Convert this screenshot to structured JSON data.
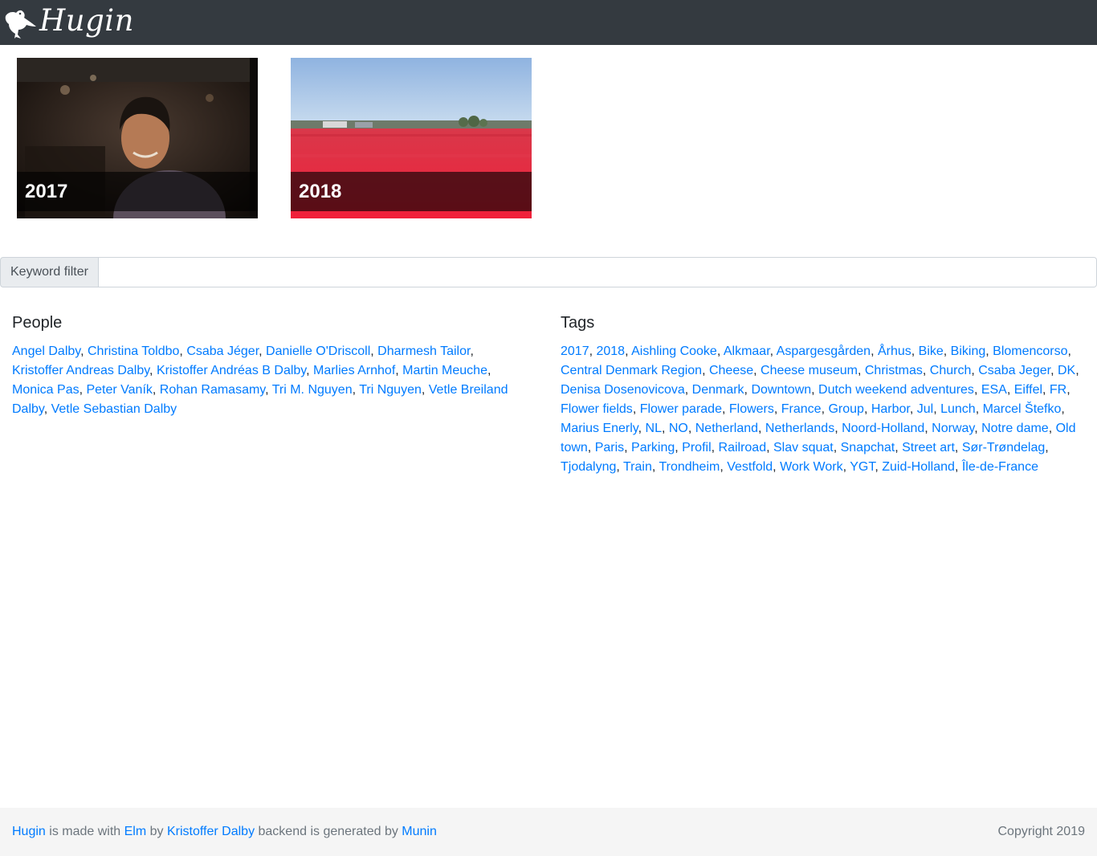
{
  "header": {
    "brand": "Hugin",
    "logo_icon": "raven-icon"
  },
  "albums": [
    {
      "year": "2017"
    },
    {
      "year": "2018"
    }
  ],
  "filter": {
    "label": "Keyword filter",
    "value": "",
    "placeholder": ""
  },
  "people": {
    "heading": "People",
    "items": [
      "Angel Dalby",
      "Christina Toldbo",
      "Csaba Jéger",
      "Danielle O'Driscoll",
      "Dharmesh Tailor",
      "Kristoffer Andreas Dalby",
      "Kristoffer Andréas B Dalby",
      "Marlies Arnhof",
      "Martin Meuche",
      "Monica Pas",
      "Peter Vaník",
      "Rohan Ramasamy",
      "Tri M. Nguyen",
      "Tri Nguyen",
      "Vetle Breiland Dalby",
      "Vetle Sebastian Dalby"
    ]
  },
  "tags": {
    "heading": "Tags",
    "items": [
      "2017",
      "2018",
      "Aishling Cooke",
      "Alkmaar",
      "Aspargesgården",
      "Århus",
      "Bike",
      "Biking",
      "Blomencorso",
      "Central Denmark Region",
      "Cheese",
      "Cheese museum",
      "Christmas",
      "Church",
      "Csaba Jeger",
      "DK",
      "Denisa Dosenovicova",
      "Denmark",
      "Downtown",
      "Dutch weekend adventures",
      "ESA",
      "Eiffel",
      "FR",
      "Flower fields",
      "Flower parade",
      "Flowers",
      "France",
      "Group",
      "Harbor",
      "Jul",
      "Lunch",
      "Marcel Štefko",
      "Marius Enerly",
      "NL",
      "NO",
      "Netherland",
      "Netherlands",
      "Noord-Holland",
      "Norway",
      "Notre dame",
      "Old town",
      "Paris",
      "Parking",
      "Profil",
      "Railroad",
      "Slav squat",
      "Snapchat",
      "Street art",
      "Sør-Trøndelag",
      "Tjodalyng",
      "Train",
      "Trondheim",
      "Vestfold",
      "Work Work",
      "YGT",
      "Zuid-Holland",
      "Île-de-France"
    ]
  },
  "footer": {
    "hugin_link": "Hugin",
    "text1": " is made with ",
    "elm_link": "Elm",
    "text2": " by ",
    "author_link": "Kristoffer Dalby",
    "text3": " backend is generated by ",
    "munin_link": "Munin",
    "copyright": "Copyright 2019"
  }
}
